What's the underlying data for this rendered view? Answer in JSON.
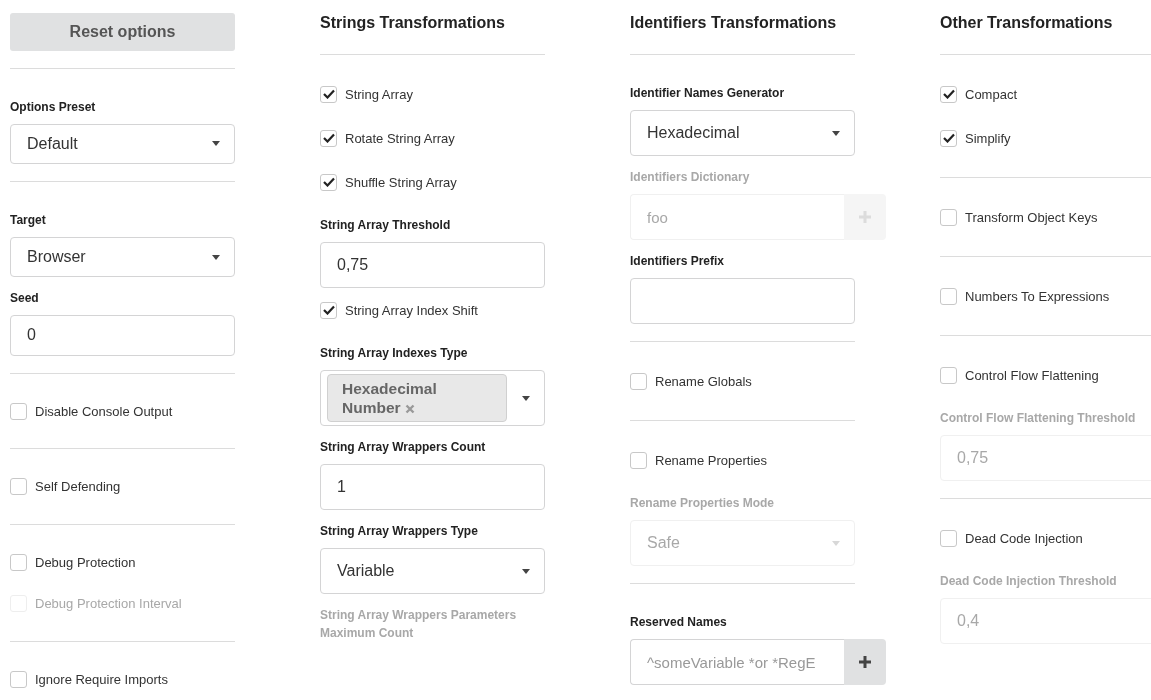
{
  "columns": [
    {
      "items": [
        {
          "kind": "button",
          "label": "Reset options"
        },
        {
          "kind": "divider"
        },
        {
          "kind": "label",
          "text": "Options Preset",
          "disabled": false
        },
        {
          "kind": "select",
          "value": "Default",
          "disabled": false
        },
        {
          "kind": "divider"
        },
        {
          "kind": "label",
          "text": "Target",
          "disabled": false
        },
        {
          "kind": "select",
          "value": "Browser",
          "disabled": false
        },
        {
          "kind": "label",
          "text": "Seed",
          "disabled": false
        },
        {
          "kind": "input",
          "value": "0",
          "disabled": false
        },
        {
          "kind": "divider"
        },
        {
          "kind": "checkbox",
          "label": "Disable Console Output",
          "checked": false,
          "disabled": false
        },
        {
          "kind": "divider"
        },
        {
          "kind": "checkbox",
          "label": "Self Defending",
          "checked": false,
          "disabled": false
        },
        {
          "kind": "divider"
        },
        {
          "kind": "checkbox",
          "label": "Debug Protection",
          "checked": false,
          "disabled": false
        },
        {
          "kind": "checkbox",
          "label": "Debug Protection Interval",
          "checked": false,
          "disabled": true
        },
        {
          "kind": "divider"
        },
        {
          "kind": "checkbox",
          "label": "Ignore Require Imports",
          "checked": false,
          "disabled": false
        }
      ]
    },
    {
      "items": [
        {
          "kind": "heading",
          "text": "Strings Transformations"
        },
        {
          "kind": "divider"
        },
        {
          "kind": "checkbox",
          "label": "String Array",
          "checked": true,
          "disabled": false
        },
        {
          "kind": "checkbox",
          "label": "Rotate String Array",
          "checked": true,
          "disabled": false
        },
        {
          "kind": "checkbox",
          "label": "Shuffle String Array",
          "checked": true,
          "disabled": false
        },
        {
          "kind": "label",
          "text": "String Array Threshold",
          "disabled": false
        },
        {
          "kind": "input",
          "value": "0,75",
          "disabled": false
        },
        {
          "kind": "checkbox",
          "label": "String Array Index Shift",
          "checked": true,
          "disabled": false
        },
        {
          "kind": "label",
          "text": "String Array Indexes Type",
          "disabled": false
        },
        {
          "kind": "tag_select",
          "tags": [
            "Hexadecimal Number"
          ]
        },
        {
          "kind": "label",
          "text": "String Array Wrappers Count",
          "disabled": false
        },
        {
          "kind": "input",
          "value": "1",
          "disabled": false
        },
        {
          "kind": "label",
          "text": "String Array Wrappers Type",
          "disabled": false
        },
        {
          "kind": "select",
          "value": "Variable",
          "disabled": false
        },
        {
          "kind": "label",
          "text": "String Array Wrappers Parameters Maximum Count",
          "disabled": true
        }
      ]
    },
    {
      "items": [
        {
          "kind": "heading",
          "text": "Identifiers Transformations"
        },
        {
          "kind": "divider"
        },
        {
          "kind": "label",
          "text": "Identifier Names Generator",
          "disabled": false
        },
        {
          "kind": "select",
          "value": "Hexadecimal",
          "disabled": false
        },
        {
          "kind": "label",
          "text": "Identifiers Dictionary",
          "disabled": true
        },
        {
          "kind": "add_input",
          "placeholder": "foo",
          "disabled": true
        },
        {
          "kind": "label",
          "text": "Identifiers Prefix",
          "disabled": false
        },
        {
          "kind": "input",
          "disabled": false
        },
        {
          "kind": "divider"
        },
        {
          "kind": "checkbox",
          "label": "Rename Globals",
          "checked": false,
          "disabled": false
        },
        {
          "kind": "divider"
        },
        {
          "kind": "checkbox",
          "label": "Rename Properties",
          "checked": false,
          "disabled": false
        },
        {
          "kind": "label",
          "text": "Rename Properties Mode",
          "disabled": true
        },
        {
          "kind": "select",
          "value": "Safe",
          "disabled": true
        },
        {
          "kind": "divider"
        },
        {
          "kind": "label",
          "text": "Reserved Names",
          "disabled": false
        },
        {
          "kind": "add_input",
          "placeholder": "^someVariable *or *RegE",
          "disabled": false
        }
      ]
    },
    {
      "items": [
        {
          "kind": "heading",
          "text": "Other Transformations"
        },
        {
          "kind": "divider"
        },
        {
          "kind": "checkbox",
          "label": "Compact",
          "checked": true,
          "disabled": false
        },
        {
          "kind": "checkbox",
          "label": "Simplify",
          "checked": true,
          "disabled": false
        },
        {
          "kind": "divider"
        },
        {
          "kind": "checkbox",
          "label": "Transform Object Keys",
          "checked": false,
          "disabled": false
        },
        {
          "kind": "divider"
        },
        {
          "kind": "checkbox",
          "label": "Numbers To Expressions",
          "checked": false,
          "disabled": false
        },
        {
          "kind": "divider"
        },
        {
          "kind": "checkbox",
          "label": "Control Flow Flattening",
          "checked": false,
          "disabled": false
        },
        {
          "kind": "label",
          "text": "Control Flow Flattening Threshold",
          "disabled": true
        },
        {
          "kind": "input",
          "value": "0,75",
          "disabled": true
        },
        {
          "kind": "divider"
        },
        {
          "kind": "checkbox",
          "label": "Dead Code Injection",
          "checked": false,
          "disabled": false
        },
        {
          "kind": "label",
          "text": "Dead Code Injection Threshold",
          "disabled": true
        },
        {
          "kind": "input",
          "value": "0,4",
          "disabled": true
        }
      ]
    }
  ]
}
